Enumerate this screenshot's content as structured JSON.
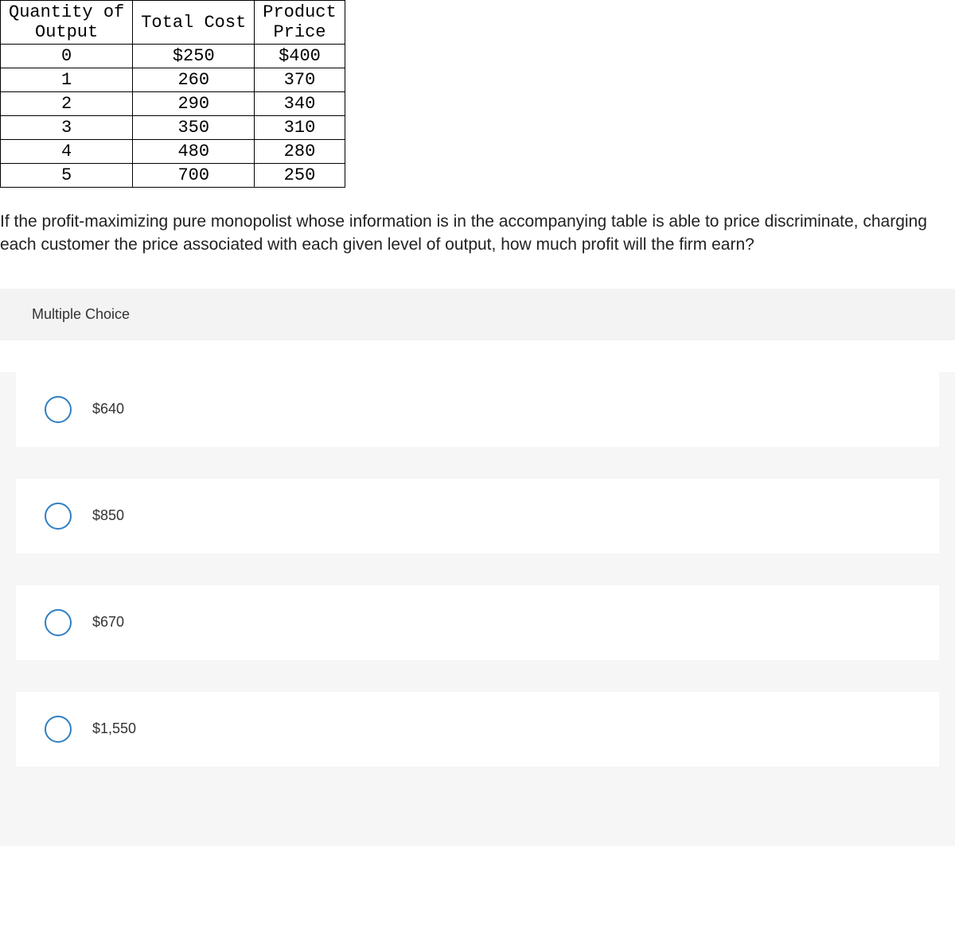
{
  "table": {
    "headers": [
      "Quantity of Output",
      "Total Cost",
      "Product Price"
    ],
    "rows": [
      {
        "qty": "0",
        "cost": "$250",
        "price": "$400"
      },
      {
        "qty": "1",
        "cost": "260",
        "price": "370"
      },
      {
        "qty": "2",
        "cost": "290",
        "price": "340"
      },
      {
        "qty": "3",
        "cost": "350",
        "price": "310"
      },
      {
        "qty": "4",
        "cost": "480",
        "price": "280"
      },
      {
        "qty": "5",
        "cost": "700",
        "price": "250"
      }
    ]
  },
  "question": "If the profit-maximizing pure monopolist whose information is in the accompanying table is able to price discriminate, charging each customer the price associated with each given level of output, how much profit will the firm earn?",
  "mc_label": "Multiple Choice",
  "options": [
    "$640",
    "$850",
    "$670",
    "$1,550"
  ]
}
